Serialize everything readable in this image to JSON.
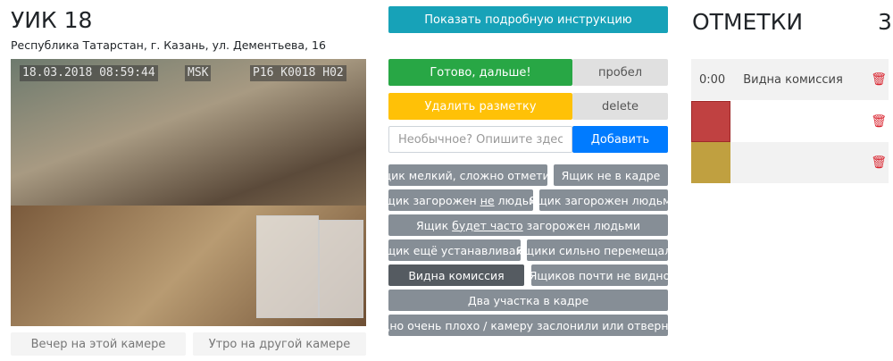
{
  "header": {
    "title": "УИК 18",
    "address": "Республика Татарстан, г. Казань, ул. Дементьева, 16"
  },
  "video": {
    "timestamp": "18.03.2018 08:59:44",
    "timezone": "MSK",
    "camera_code": "P16 K0018 H02"
  },
  "camera_nav": {
    "evening": "Вечер на этой камере",
    "morning_other": "Утро на другой камере"
  },
  "controls": {
    "instructions": "Показать подробную инструкцию",
    "done": "Готово, дальше!",
    "done_key": "пробел",
    "clear": "Удалить разметку",
    "clear_key": "delete",
    "custom_placeholder": "Необычное? Опишите здесь!",
    "add": "Добавить"
  },
  "tags": {
    "t1": "Ящик мелкий, сложно отметить",
    "t2": "Ящик не в кадре",
    "t3a": "Ящик загорожен ",
    "t3u": "не",
    "t3b": " людьми",
    "t4": "Ящик загорожен людьми",
    "t5a": "Ящик ",
    "t5u": "будет часто",
    "t5b": " загорожен людьми",
    "t6": "Ящик ещё устанавливают",
    "t7": "Ящики сильно перемещали",
    "t8": "Видна комиссия",
    "t9": "Ящиков почти не видно",
    "t10": "Два участка в кадре",
    "t11": "Видно очень плохо / камеру заслонили или отвернули"
  },
  "marks": {
    "title": "ОТМЕТКИ",
    "count": "3",
    "items": [
      {
        "time": "0:00",
        "label": "Видна комиссия"
      },
      {
        "color": "#c04141"
      },
      {
        "color": "#c0a040"
      }
    ]
  },
  "colors": {
    "teal": "#17a2b8",
    "green": "#28a745",
    "yellow": "#ffc107",
    "blue": "#007bff",
    "tag": "#868e96",
    "tag_active": "#555b61",
    "trash": "#d9232e"
  }
}
